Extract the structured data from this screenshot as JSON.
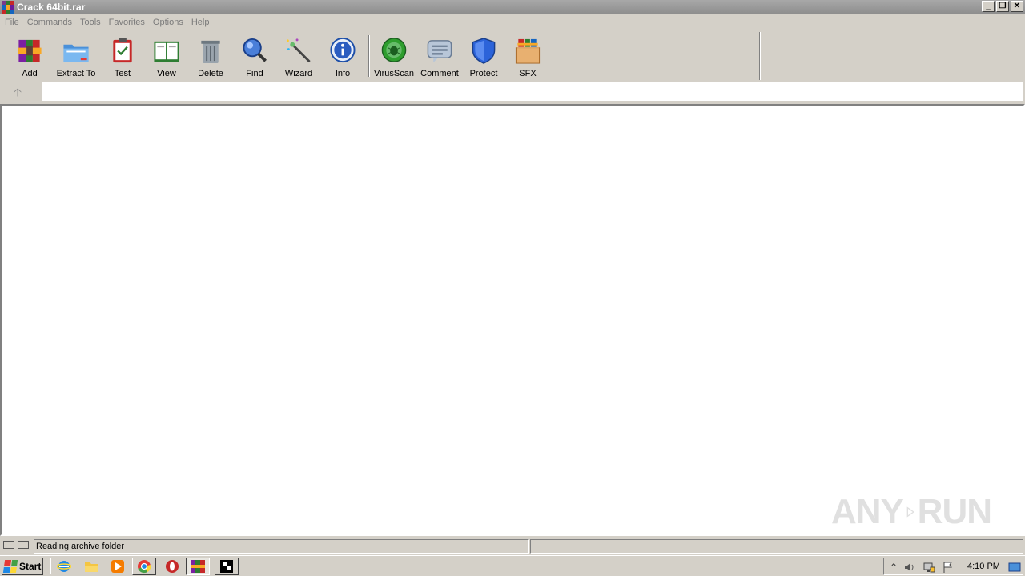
{
  "window": {
    "title": "Crack 64bit.rar",
    "minimize": "_",
    "restore": "❐",
    "close": "✕"
  },
  "menu": [
    "File",
    "Commands",
    "Tools",
    "Favorites",
    "Options",
    "Help"
  ],
  "toolbar": {
    "add": "Add",
    "extract_to": "Extract To",
    "test": "Test",
    "view": "View",
    "delete": "Delete",
    "find": "Find",
    "wizard": "Wizard",
    "info": "Info",
    "virusscan": "VirusScan",
    "comment": "Comment",
    "protect": "Protect",
    "sfx": "SFX"
  },
  "address": {
    "up_arrow": "🡡",
    "path": ""
  },
  "status": {
    "text": "Reading archive folder",
    "right": ""
  },
  "watermark": {
    "left": "ANY",
    "right": "RUN"
  },
  "taskbar": {
    "start": "Start",
    "clock": "4:10 PM"
  },
  "colors": {
    "face": "#d4d0c8",
    "title_bar": "#8c8c8c",
    "disabled_text": "#7a7a7a"
  }
}
